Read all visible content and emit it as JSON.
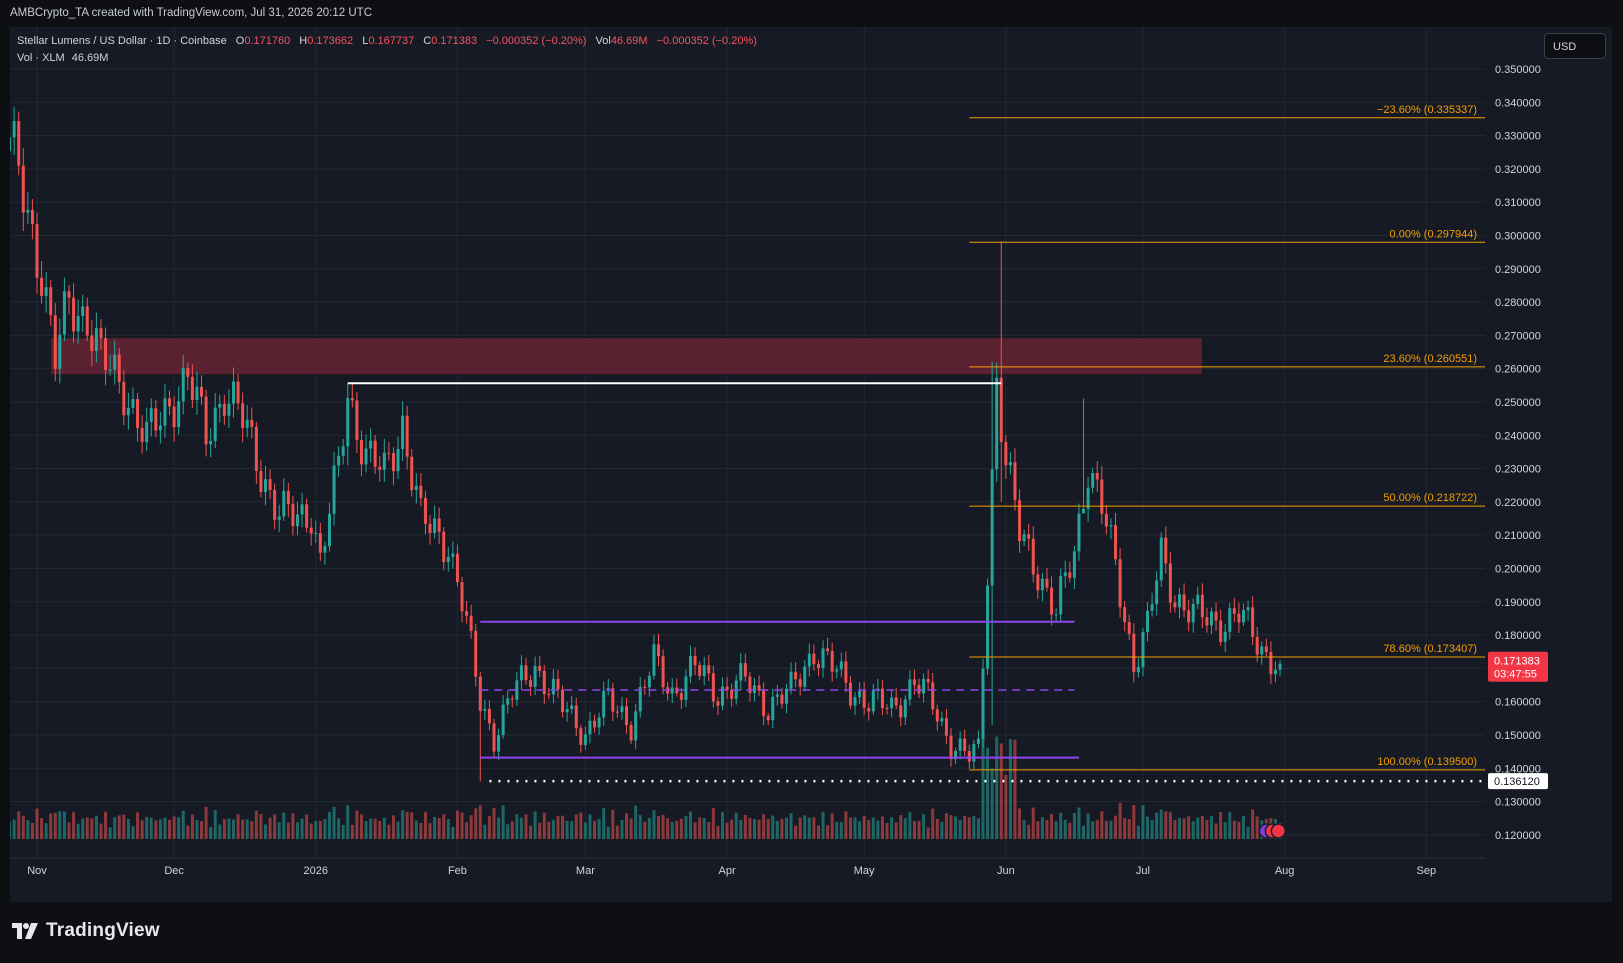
{
  "header": {
    "credit": "AMBCrypto_TA created with TradingView.com, Jul 31, 2026 20:12 UTC"
  },
  "legend": {
    "symbol": "Stellar Lumens / US Dollar · 1D · Coinbase",
    "o_label": "O",
    "o_value": "0.171760",
    "h_label": "H",
    "h_value": "0.173662",
    "l_label": "L",
    "l_value": "0.167737",
    "c_label": "C",
    "c_value": "0.171383",
    "change": "−0.000352 (−0.20%)",
    "vol_label": "Vol",
    "vol_value": "46.69M",
    "vol_change": "−0.000352 (−0.20%)",
    "vol_line_label": "Vol · XLM",
    "vol_line_value": "46.69M"
  },
  "toolbar": {
    "currency": "USD"
  },
  "footer": {
    "brand": "TradingView"
  },
  "colors": {
    "bg": "#161a25",
    "up": "#26a69a",
    "down": "#ef5350",
    "grid": "#242833",
    "fib": "#f59f00",
    "range": "#8e44ec",
    "zone_fill": "#5a2130",
    "zone_border": "#1a1a1a",
    "text": "#d1d4dc",
    "price_label_bg": "#f23645"
  },
  "chart_data": {
    "type": "candlestick",
    "ylim": [
      0.115,
      0.355
    ],
    "y_ticks": [
      "0.350000",
      "0.340000",
      "0.330000",
      "0.320000",
      "0.310000",
      "0.300000",
      "0.290000",
      "0.280000",
      "0.270000",
      "0.260000",
      "0.250000",
      "0.240000",
      "0.230000",
      "0.220000",
      "0.210000",
      "0.200000",
      "0.190000",
      "0.180000",
      "0.170000",
      "0.160000",
      "0.150000",
      "0.140000",
      "0.130000",
      "0.120000"
    ],
    "x_ticks": [
      {
        "label": "Nov",
        "date": "2025-11-01"
      },
      {
        "label": "Dec",
        "date": "2025-12-01"
      },
      {
        "label": "2026",
        "date": "2026-01-01"
      },
      {
        "label": "Feb",
        "date": "2026-02-01"
      },
      {
        "label": "Mar",
        "date": "2026-03-01"
      },
      {
        "label": "Apr",
        "date": "2026-04-01"
      },
      {
        "label": "May",
        "date": "2026-05-01"
      },
      {
        "label": "Jun",
        "date": "2026-06-01"
      },
      {
        "label": "Jul",
        "date": "2026-07-01"
      },
      {
        "label": "Aug",
        "date": "2026-08-01"
      },
      {
        "label": "Sep",
        "date": "2026-09-01"
      }
    ],
    "close_path": [
      [
        "2025-10-24",
        0.335
      ],
      [
        "2025-10-28",
        0.318
      ],
      [
        "2025-11-02",
        0.29
      ],
      [
        "2025-11-05",
        0.262
      ],
      [
        "2025-11-08",
        0.28
      ],
      [
        "2025-11-12",
        0.276
      ],
      [
        "2025-11-15",
        0.262
      ],
      [
        "2025-11-20",
        0.255
      ],
      [
        "2025-11-25",
        0.238
      ],
      [
        "2025-11-30",
        0.25
      ],
      [
        "2025-12-04",
        0.257
      ],
      [
        "2025-12-08",
        0.24
      ],
      [
        "2025-12-12",
        0.254
      ],
      [
        "2025-12-16",
        0.244
      ],
      [
        "2025-12-20",
        0.23
      ],
      [
        "2025-12-24",
        0.216
      ],
      [
        "2025-12-28",
        0.215
      ],
      [
        "2025-12-31",
        0.218
      ],
      [
        "2026-01-02",
        0.202
      ],
      [
        "2026-01-06",
        0.23
      ],
      [
        "2026-01-08",
        0.253
      ],
      [
        "2026-01-12",
        0.234
      ],
      [
        "2026-01-16",
        0.228
      ],
      [
        "2026-01-20",
        0.244
      ],
      [
        "2026-01-24",
        0.214
      ],
      [
        "2026-01-30",
        0.208
      ],
      [
        "2026-02-02",
        0.19
      ],
      [
        "2026-02-06",
        0.16
      ],
      [
        "2026-02-09",
        0.15
      ],
      [
        "2026-02-13",
        0.162
      ],
      [
        "2026-02-18",
        0.171
      ],
      [
        "2026-02-24",
        0.158
      ],
      [
        "2026-03-01",
        0.151
      ],
      [
        "2026-03-06",
        0.16
      ],
      [
        "2026-03-11",
        0.154
      ],
      [
        "2026-03-16",
        0.172
      ],
      [
        "2026-03-20",
        0.163
      ],
      [
        "2026-03-25",
        0.17
      ],
      [
        "2026-03-30",
        0.163
      ],
      [
        "2026-04-05",
        0.166
      ],
      [
        "2026-04-10",
        0.159
      ],
      [
        "2026-04-15",
        0.163
      ],
      [
        "2026-04-20",
        0.176
      ],
      [
        "2026-04-24",
        0.17
      ],
      [
        "2026-04-28",
        0.164
      ],
      [
        "2026-05-02",
        0.16
      ],
      [
        "2026-05-07",
        0.158
      ],
      [
        "2026-05-12",
        0.166
      ],
      [
        "2026-05-16",
        0.159
      ],
      [
        "2026-05-20",
        0.148
      ],
      [
        "2026-05-24",
        0.143
      ],
      [
        "2026-05-26",
        0.145
      ],
      [
        "2026-05-28",
        0.2
      ],
      [
        "2026-05-30",
        0.258
      ],
      [
        "2026-06-01",
        0.232
      ],
      [
        "2026-06-04",
        0.21
      ],
      [
        "2026-06-08",
        0.2
      ],
      [
        "2026-06-12",
        0.186
      ],
      [
        "2026-06-16",
        0.205
      ],
      [
        "2026-06-19",
        0.232
      ],
      [
        "2026-06-22",
        0.218
      ],
      [
        "2026-06-25",
        0.2
      ],
      [
        "2026-06-29",
        0.172
      ],
      [
        "2026-07-02",
        0.182
      ],
      [
        "2026-07-05",
        0.204
      ],
      [
        "2026-07-08",
        0.192
      ],
      [
        "2026-07-12",
        0.186
      ],
      [
        "2026-07-17",
        0.184
      ],
      [
        "2026-07-22",
        0.186
      ],
      [
        "2026-07-27",
        0.176
      ],
      [
        "2026-07-31",
        0.171383
      ]
    ],
    "key_candles": [
      {
        "date": "2026-01-08",
        "low": 0.231,
        "high": 0.2556
      },
      {
        "date": "2026-02-06",
        "low": 0.1361,
        "high": 0.169
      },
      {
        "date": "2026-05-29",
        "low": 0.153,
        "high": 0.262
      },
      {
        "date": "2026-05-31",
        "low": 0.22,
        "high": 0.2979
      },
      {
        "date": "2026-06-18",
        "low": 0.218,
        "high": 0.251
      }
    ],
    "annotations": {
      "fib_levels": [
        {
          "label": "−23.60% (0.335337)",
          "value": 0.335337
        },
        {
          "label": "0.00% (0.297944)",
          "value": 0.297944
        },
        {
          "label": "23.60% (0.260551)",
          "value": 0.260551
        },
        {
          "label": "50.00% (0.218722)",
          "value": 0.218722
        },
        {
          "label": "78.60% (0.173407)",
          "value": 0.173407
        },
        {
          "label": "100.00% (0.139500)",
          "value": 0.1395
        }
      ],
      "resistance_zone": {
        "from": "2025-11-04",
        "to": "2026-07-14",
        "low": 0.2582,
        "high": 0.2693
      },
      "white_line": {
        "from": "2026-01-08",
        "to": "2026-05-31",
        "value": 0.2556
      },
      "range_top": {
        "from": "2026-02-06",
        "to": "2026-06-16",
        "value": 0.184
      },
      "range_mid": {
        "from": "2026-02-06",
        "to": "2026-06-16",
        "value": 0.1635
      },
      "range_bottom": {
        "from": "2026-02-06",
        "to": "2026-06-17",
        "value": 0.1432
      },
      "support_line": {
        "from": "2026-02-08",
        "value": 0.13612,
        "label": "0.136120"
      }
    },
    "last_price": {
      "value": 0.171383,
      "label": "0.171383",
      "countdown": "03:47:55"
    },
    "volume": {
      "last": "46.69M",
      "unit": "XLM"
    }
  }
}
